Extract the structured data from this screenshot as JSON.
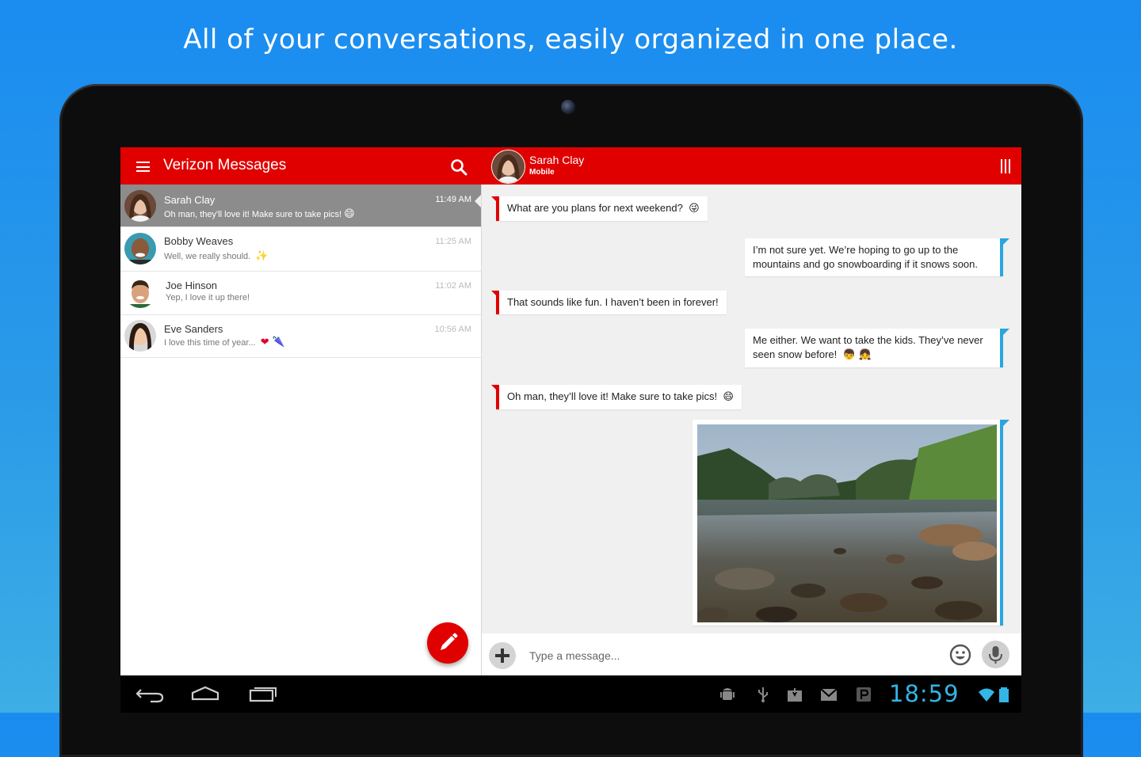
{
  "headline": "All of your conversations, easily organized in one place.",
  "app": {
    "title": "Verizon Messages",
    "brand_color": "#e00000",
    "outgoing_color": "#29a6e0"
  },
  "conversations": [
    {
      "name": "Sarah Clay",
      "snippet": "Oh man, they'll love it! Make sure to take pics!",
      "emoji": "😄",
      "time": "11:49 AM",
      "active": true
    },
    {
      "name": "Bobby Weaves",
      "snippet": "Well, we really should.",
      "emoji": "✨",
      "time": "11:25 AM",
      "active": false
    },
    {
      "name": "Joe Hinson",
      "snippet": "Yep, I love it up there!",
      "emoji": "",
      "time": "11:02 AM",
      "active": false
    },
    {
      "name": "Eve Sanders",
      "snippet": "I love this time of year...",
      "emoji": "❤ 🌂",
      "time": "10:56 AM",
      "active": false
    }
  ],
  "chat": {
    "contact_name": "Sarah Clay",
    "contact_type": "Mobile",
    "messages": [
      {
        "direction": "in",
        "text": "What are you plans for next weekend?",
        "emoji": "😜"
      },
      {
        "direction": "out",
        "text_line1": "I’m not sure yet. We’re hoping to go up to the",
        "text_line2": "mountains and go snowboarding if it snows soon."
      },
      {
        "direction": "in",
        "text": "That sounds like fun. I haven’t been in forever!"
      },
      {
        "direction": "out",
        "text_line1": "Me either. We want to take the kids. They’ve never",
        "text_line2": "seen snow before!",
        "emoji": "👦 👧"
      },
      {
        "direction": "in",
        "text": "Oh man, they’ll love it! Make sure to take pics!",
        "emoji": "😄"
      },
      {
        "direction": "out",
        "type": "photo",
        "content": "lake landscape photo"
      }
    ],
    "composer": {
      "placeholder": "Type a message..."
    }
  },
  "system_bar": {
    "clock": "18:59",
    "icons": [
      "android-debug-icon",
      "usb-icon",
      "download-icon",
      "gmail-icon",
      "p-app-icon",
      "wifi-icon",
      "battery-icon"
    ],
    "nav": [
      "back-icon",
      "home-icon",
      "recents-icon"
    ]
  }
}
